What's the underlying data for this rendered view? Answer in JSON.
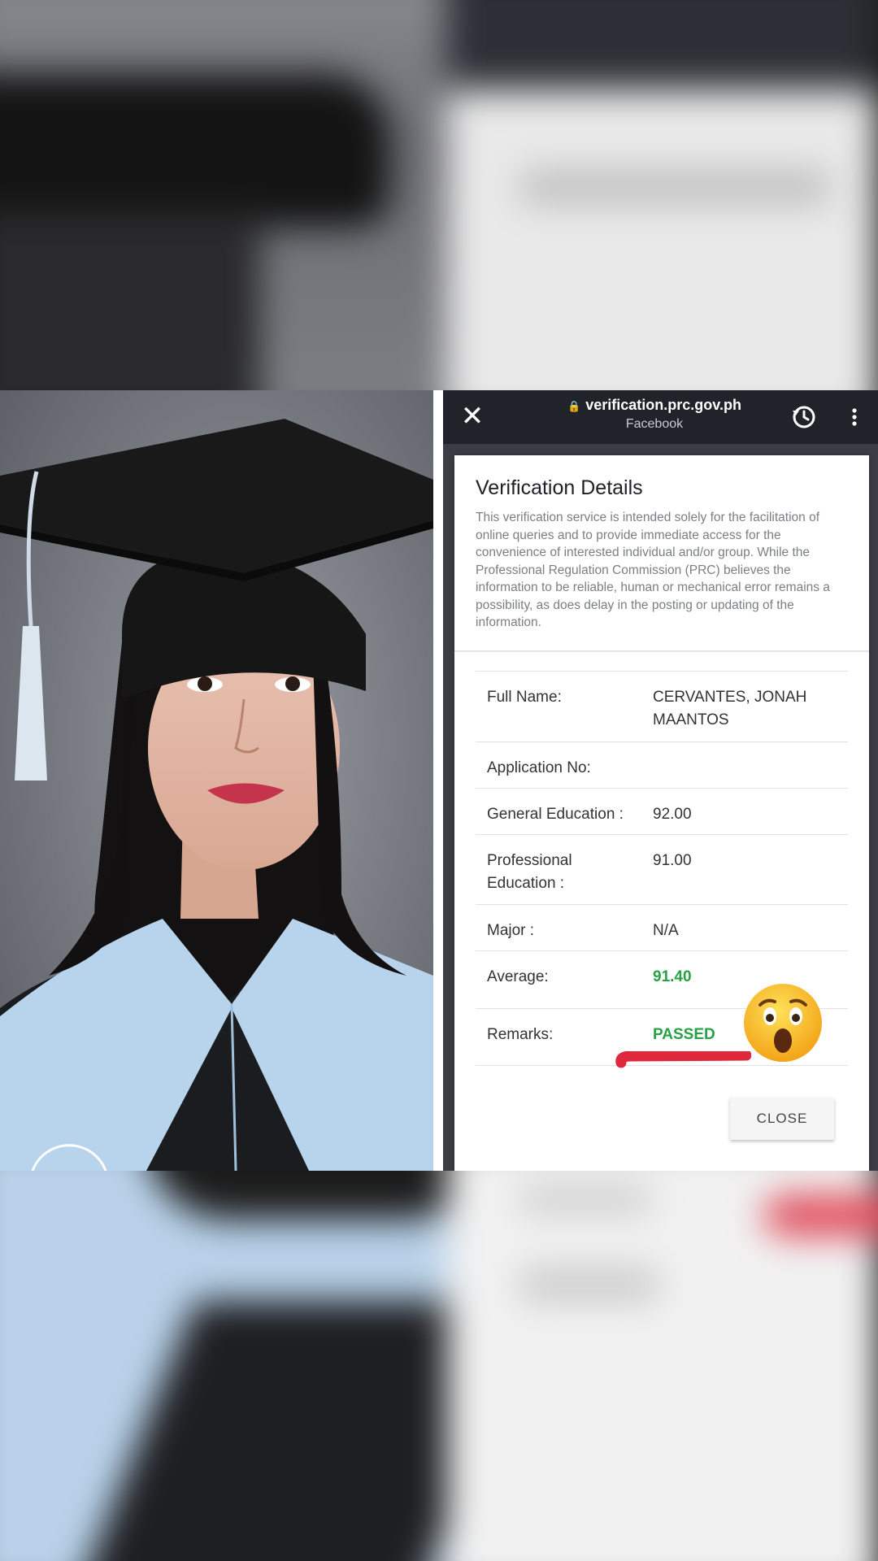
{
  "browser": {
    "url": "verification.prc.gov.ph",
    "source": "Facebook"
  },
  "dialog": {
    "title": "Verification Details",
    "description": "This verification service is intended solely for the facilitation of online queries and to provide immediate access for the convenience of interested individual and/or group. While the Professional Regulation Commission (PRC) believes the information to be reliable, human or mechanical error remains a possibility, as does delay in the posting or updating of the information.",
    "rows": [
      {
        "label": "Full Name:",
        "value": "CERVANTES, JONAH MAANTOS"
      },
      {
        "label": "Application No:",
        "value": ""
      },
      {
        "label": "General Education :",
        "value": "92.00"
      },
      {
        "label": "Professional Education :",
        "value": "91.00"
      },
      {
        "label": "Major :",
        "value": "N/A"
      },
      {
        "label": "Average:",
        "value": "91.40"
      },
      {
        "label": "Remarks:",
        "value": "PASSED"
      }
    ],
    "close_label": "CLOSE"
  },
  "colors": {
    "green": "#27a145",
    "red_mark": "#e0283c",
    "topbar": "#202329"
  },
  "icons": {
    "close": "close-icon",
    "lock": "lock-icon",
    "history": "history-icon",
    "menu": "kebab-menu-icon",
    "emoji": "astonished-face-emoji"
  }
}
